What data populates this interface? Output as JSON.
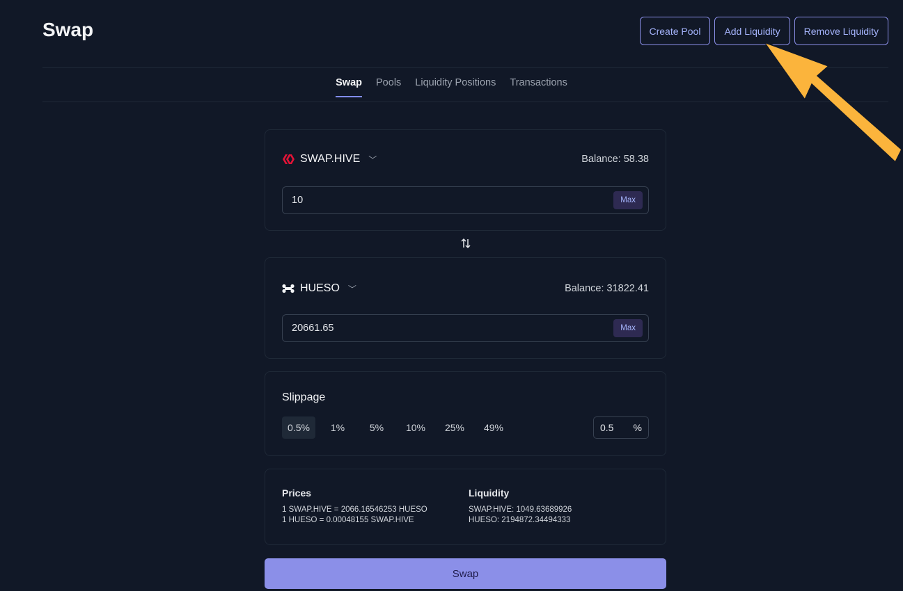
{
  "page_title": "Swap",
  "header_buttons": {
    "create_pool": "Create Pool",
    "add_liquidity": "Add Liquidity",
    "remove_liquidity": "Remove Liquidity"
  },
  "tabs": [
    {
      "label": "Swap",
      "active": true
    },
    {
      "label": "Pools",
      "active": false
    },
    {
      "label": "Liquidity Positions",
      "active": false
    },
    {
      "label": "Transactions",
      "active": false
    }
  ],
  "from_token": {
    "symbol": "SWAP.HIVE",
    "icon": "hive-icon",
    "balance_label": "Balance: 58.38",
    "amount": "10",
    "max_label": "Max"
  },
  "to_token": {
    "symbol": "HUESO",
    "icon": "bone-icon",
    "balance_label": "Balance: 31822.41",
    "amount": "20661.65",
    "max_label": "Max"
  },
  "slippage": {
    "title": "Slippage",
    "options": [
      "0.5%",
      "1%",
      "5%",
      "10%",
      "25%",
      "49%"
    ],
    "selected": "0.5%",
    "custom_value": "0.5",
    "custom_unit": "%"
  },
  "prices": {
    "title": "Prices",
    "line1": "1 SWAP.HIVE = 2066.16546253 HUESO",
    "line2": "1 HUESO = 0.00048155 SWAP.HIVE"
  },
  "liquidity": {
    "title": "Liquidity",
    "line1": "SWAP.HIVE: 1049.63689926",
    "line2": "HUESO: 2194872.34494333"
  },
  "swap_button": "Swap",
  "colors": {
    "background": "#111827",
    "accent": "#8b8fe8",
    "hive_red": "#e31337",
    "annotation_arrow": "#fbb43c"
  }
}
